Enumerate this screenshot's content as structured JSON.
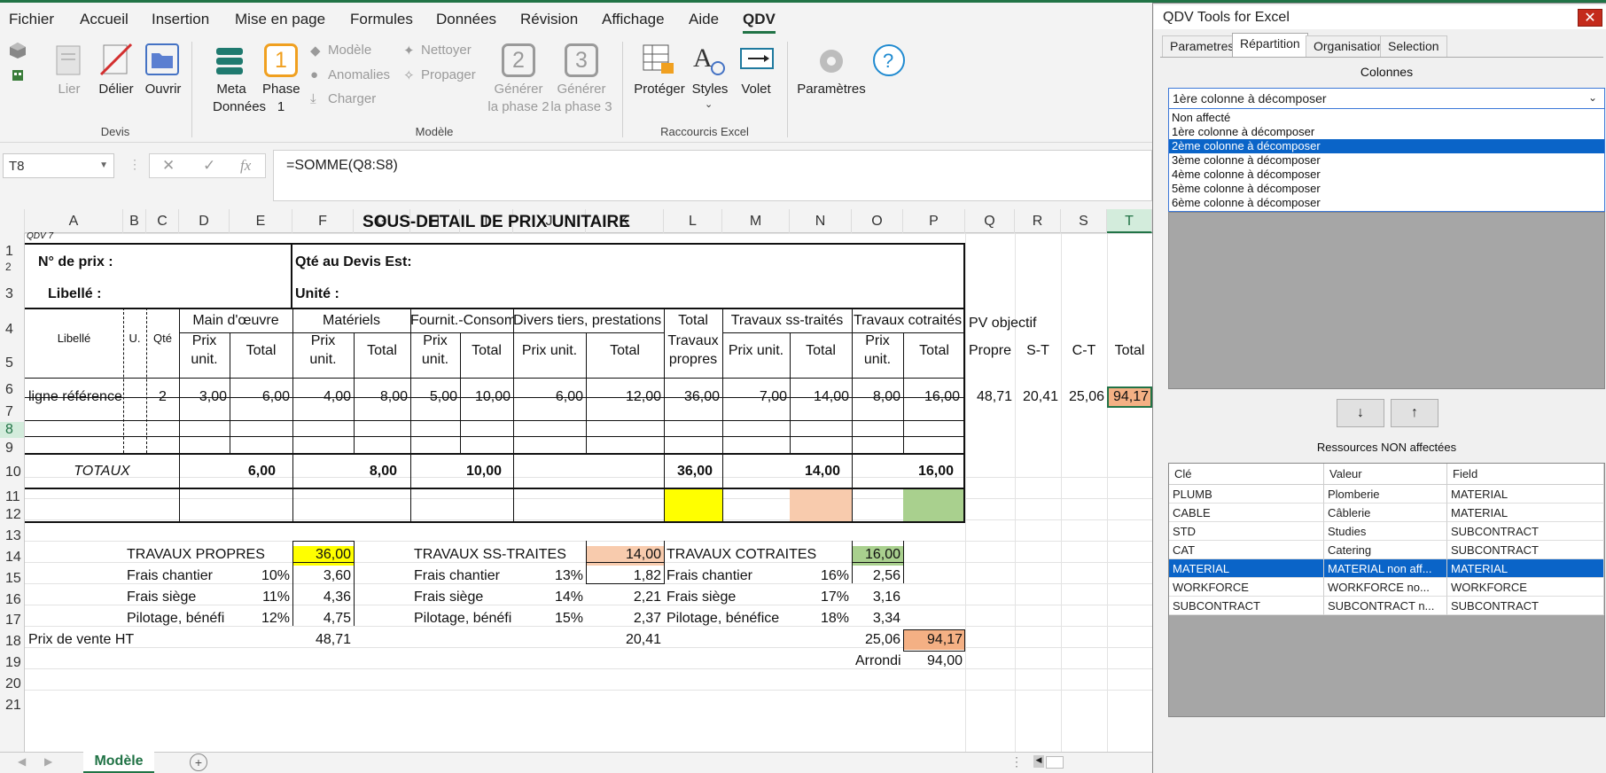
{
  "menu": [
    "Fichier",
    "Accueil",
    "Insertion",
    "Mise en page",
    "Formules",
    "Données",
    "Révision",
    "Affichage",
    "Aide",
    "QDV"
  ],
  "ribbon": {
    "devis": {
      "lier": "Lier",
      "delier": "Délier",
      "ouvrir": "Ouvrir",
      "group": "Devis"
    },
    "modele": {
      "meta1": "Meta",
      "meta2": "Données",
      "phase1a": "Phase",
      "phase1b": "1",
      "phase1num": "1",
      "modele": "Modèle",
      "anomalies": "Anomalies",
      "charger": "Charger",
      "nettoyer": "Nettoyer",
      "propager": "Propager",
      "gen2a": "Générer",
      "gen2b": "la phase 2",
      "gen2num": "2",
      "gen3a": "Générer",
      "gen3b": "la phase 3",
      "gen3num": "3",
      "group": "Modèle"
    },
    "raccourcis": {
      "proteger": "Protéger",
      "styles": "Styles",
      "volet": "Volet",
      "group": "Raccourcis Excel"
    },
    "parametres": "Paramètres"
  },
  "formulabar": {
    "namebox": "T8",
    "formula": "=SOMME(Q8:S8)",
    "fx": "fx"
  },
  "columns": [
    "A",
    "B",
    "C",
    "D",
    "E",
    "F",
    "G",
    "H",
    "I",
    "J",
    "K",
    "L",
    "M",
    "N",
    "O",
    "P",
    "Q",
    "R",
    "S",
    "T"
  ],
  "rows": [
    "1",
    "2",
    "3",
    "4",
    "5",
    "6",
    "7",
    "8",
    "9",
    "10",
    "11",
    "12",
    "13",
    "14",
    "15",
    "16",
    "17",
    "18",
    "19",
    "20",
    "21"
  ],
  "sheet": {
    "title": "SOUS-DETAIL DE PRIX UNITAIRE",
    "qdv": "QDV 7",
    "no_prix": "N° de prix :",
    "qte_devis": "Qté au Devis Est:",
    "libelle_lbl": "Libellé :",
    "unite": "Unité :",
    "h_libelle": "Libellé",
    "h_u": "U.",
    "h_qte": "Qté",
    "h_main": "Main d'œuvre",
    "h_mat": "Matériels",
    "h_fourn": "Fournit.-Consom",
    "h_divers": "Divers tiers, prestations",
    "h_total_tp1": "Total",
    "h_total_tp2": "Travaux",
    "h_total_tp3": "propres",
    "h_ss": "Travaux ss-traités",
    "h_cot": "Travaux cotraités",
    "h_pv": "PV objectif",
    "h_prix": "Prix",
    "h_unit": "unit.",
    "h_total": "Total",
    "h_prixunit": "Prix unit.",
    "h_propre": "Propre",
    "h_st": "S-T",
    "h_ct": "C-T",
    "h_tot": "Total",
    "r8": {
      "lib": "ligne référence",
      "qte": "2",
      "d": "3,00",
      "e": "6,00",
      "f": "4,00",
      "g": "8,00",
      "h": "5,00",
      "i": "10,00",
      "j": "6,00",
      "k": "12,00",
      "l": "36,00",
      "m": "7,00",
      "n": "14,00",
      "o": "8,00",
      "p": "16,00",
      "q": "48,71",
      "r": "20,41",
      "s": "25,06",
      "t": "94,17"
    },
    "totaux": {
      "lbl": "TOTAUX",
      "e": "6,00",
      "g": "8,00",
      "i": "10,00",
      "l": "36,00",
      "n": "14,00",
      "p": "16,00"
    },
    "recap": {
      "tp": "TRAVAUX PROPRES",
      "tp_v": "36,00",
      "ts": "TRAVAUX SS-TRAITES",
      "ts_v": "14,00",
      "tc": "TRAVAUX COTRAITES",
      "tc_v": "16,00",
      "fc": "Frais chantier",
      "fs": "Frais siège",
      "pb": "Pilotage, bénéfi",
      "pb_full": "Pilotage, bénéfice",
      "tp_fc_p": "10%",
      "tp_fc": "3,60",
      "tp_fs_p": "11%",
      "tp_fs": "4,36",
      "tp_pb_p": "12%",
      "tp_pb": "4,75",
      "ts_fc_p": "13%",
      "ts_fc": "1,82",
      "ts_fs_p": "14%",
      "ts_fs": "2,21",
      "ts_pb_p": "15%",
      "ts_pb": "2,37",
      "tc_fc_p": "16%",
      "tc_fc": "2,56",
      "tc_fs_p": "17%",
      "tc_fs": "3,16",
      "tc_pb_p": "18%",
      "tc_pb": "3,34",
      "pv": "Prix de vente HT",
      "pv_tp": "48,71",
      "pv_ts": "20,41",
      "pv_tc": "25,06",
      "pv_tot": "94,17",
      "arrondi": "Arrondi",
      "arrondi_v": "94,00"
    }
  },
  "sheettab": "Modèle",
  "dialog": {
    "title": "QDV Tools for Excel",
    "tabs": [
      "Parametres",
      "Répartition",
      "Organisation",
      "Selection"
    ],
    "colonnes": "Colonnes",
    "combo_value": "1ère colonne à décomposer",
    "options": [
      "Non affecté",
      "1ère colonne à décomposer",
      "2ème colonne à décomposer",
      "3ème colonne à décomposer",
      "4ème colonne à décomposer",
      "5ème colonne à décomposer",
      "6ème colonne à décomposer"
    ],
    "btn_down": "↓",
    "btn_up": "↑",
    "ressources": "Ressources NON affectées",
    "table_headers": [
      "Clé",
      "Valeur",
      "Field"
    ],
    "table_rows": [
      [
        "PLUMB",
        "Plomberie",
        "MATERIAL"
      ],
      [
        "CABLE",
        "Câblerie",
        "MATERIAL"
      ],
      [
        "STD",
        "Studies",
        "SUBCONTRACT"
      ],
      [
        "CAT",
        "Catering",
        "SUBCONTRACT"
      ],
      [
        "MATERIAL",
        "MATERIAL non aff...",
        "MATERIAL"
      ],
      [
        "WORKFORCE",
        "WORKFORCE no...",
        "WORKFORCE"
      ],
      [
        "SUBCONTRACT",
        "SUBCONTRACT n...",
        "SUBCONTRACT"
      ]
    ]
  },
  "colors": {
    "excel_green": "#217346",
    "yellow": "#ffff00",
    "salmon": "#f8cbad",
    "green": "#a9d08e",
    "orange": "#f4b084",
    "select_blue": "#0a64c8"
  }
}
